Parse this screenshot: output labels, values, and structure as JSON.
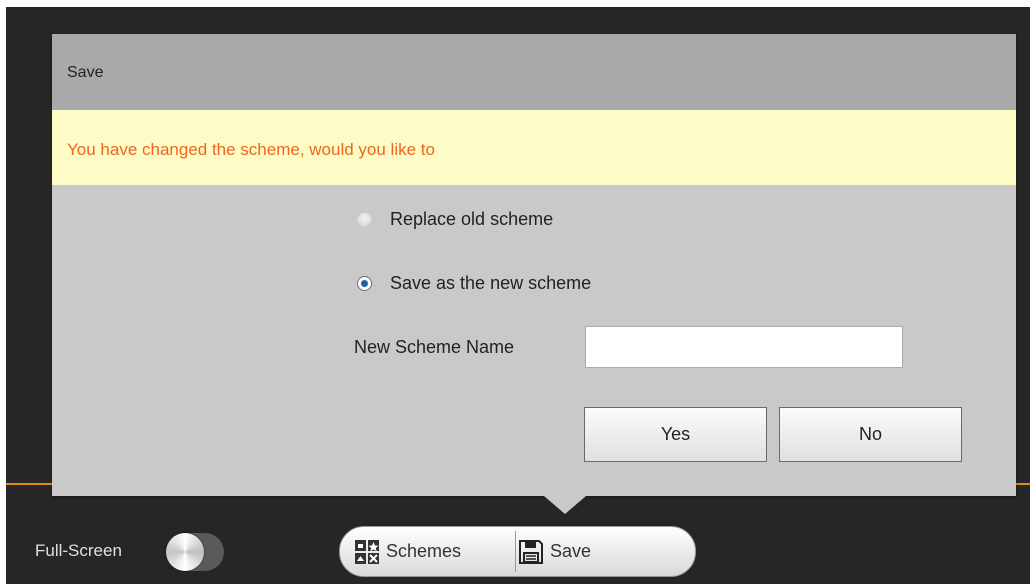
{
  "dialog": {
    "title": "Save",
    "warning": "You have changed the scheme, would you like to",
    "options": [
      {
        "label": "Replace old scheme",
        "selected": false
      },
      {
        "label": "Save as the new scheme",
        "selected": true
      }
    ],
    "name_label": "New Scheme Name",
    "name_value": "",
    "yes_label": "Yes",
    "no_label": "No"
  },
  "bottombar": {
    "fullscreen_label": "Full-Screen",
    "fullscreen_on": false,
    "schemes_label": "Schemes",
    "save_label": "Save",
    "schemes_icon": "schemes-icon",
    "save_icon": "floppy-disk-icon"
  },
  "colors": {
    "warning_text": "#f0661e",
    "warning_bg": "#fdfbc6",
    "accent_line": "#e08a1a"
  }
}
